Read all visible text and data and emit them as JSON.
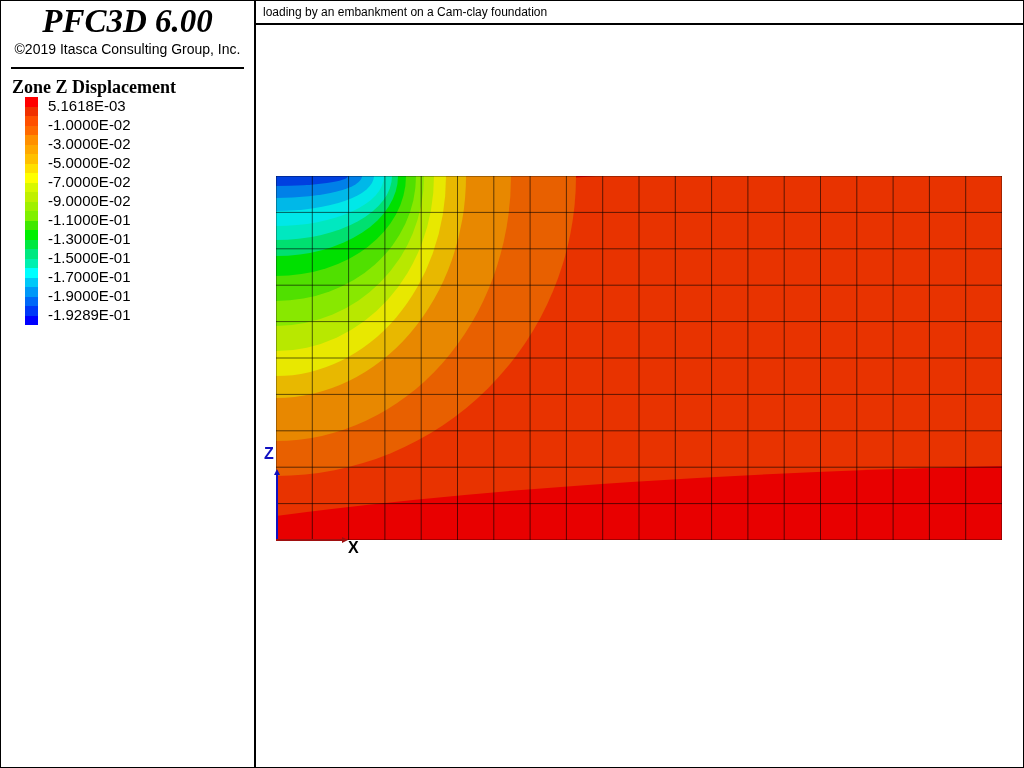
{
  "sidebar": {
    "title": "PFC3D 6.00",
    "copyright": "©2019 Itasca Consulting Group, Inc.",
    "legend": {
      "title": "Zone Z Displacement",
      "swatches": [
        {
          "color": "#ff0000"
        },
        {
          "color": "#f03000"
        },
        {
          "color": "#ff5000"
        },
        {
          "color": "#ff6a00"
        },
        {
          "color": "#ff9000"
        },
        {
          "color": "#ffa800"
        },
        {
          "color": "#ffc000"
        },
        {
          "color": "#ffe000"
        },
        {
          "color": "#ffff00"
        },
        {
          "color": "#d8f800"
        },
        {
          "color": "#c0f000"
        },
        {
          "color": "#a0f000"
        },
        {
          "color": "#80f000"
        },
        {
          "color": "#40e800"
        },
        {
          "color": "#00f000"
        },
        {
          "color": "#00e840"
        },
        {
          "color": "#00e880"
        },
        {
          "color": "#00f0b0"
        },
        {
          "color": "#00ffff"
        },
        {
          "color": "#00c8f8"
        },
        {
          "color": "#0098f8"
        },
        {
          "color": "#0068f8"
        },
        {
          "color": "#0038f8"
        },
        {
          "color": "#0000ff"
        }
      ],
      "labels": [
        "5.1618E-03",
        "-1.0000E-02",
        "-3.0000E-02",
        "-5.0000E-02",
        "-7.0000E-02",
        "-9.0000E-02",
        "-1.1000E-01",
        "-1.3000E-01",
        "-1.5000E-01",
        "-1.7000E-01",
        "-1.9000E-01",
        "-1.9289E-01"
      ]
    }
  },
  "view": {
    "title": "loading by an embankment on a Cam-clay foundation",
    "z_axis_label": "Z",
    "x_axis_label": "X"
  }
}
